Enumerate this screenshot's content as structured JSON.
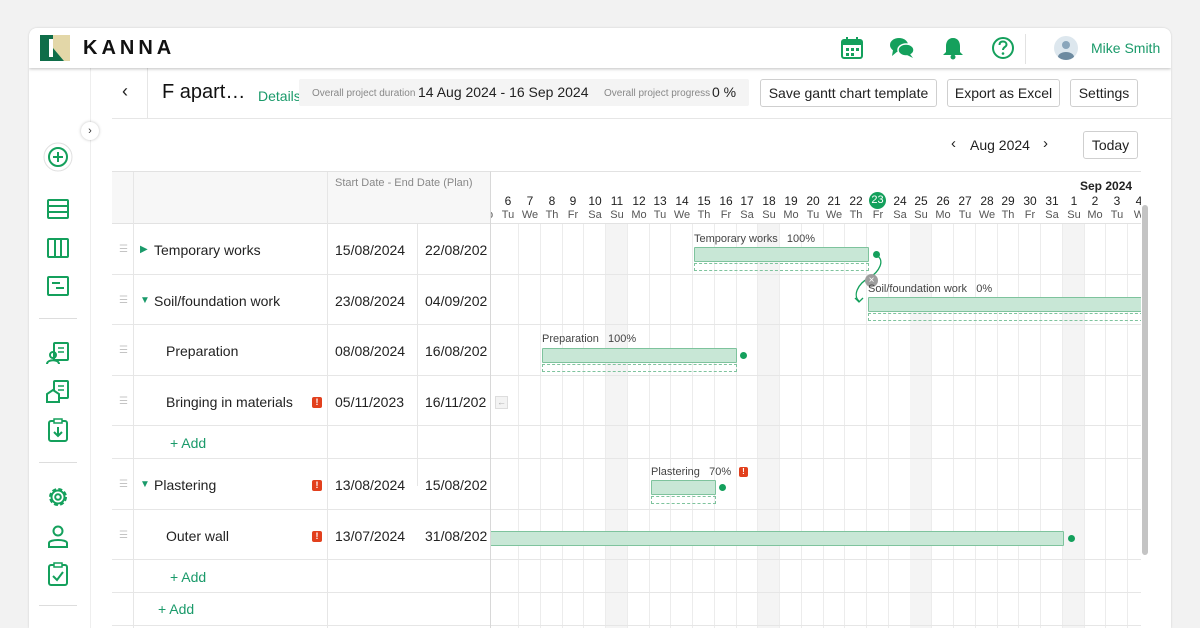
{
  "app": {
    "brand": "KANNA",
    "user_name": "Mike Smith",
    "colors": {
      "accent": "#1a9a6a",
      "bar_fill": "#c8e7d6",
      "warning": "#e2401d"
    },
    "top_icons": [
      "calendar-icon",
      "chat-icon",
      "bell-icon",
      "help-icon"
    ]
  },
  "sidebar": {
    "items": [
      "add-icon",
      "list-icon",
      "board-icon",
      "schedule-icon",
      "customer-list-icon",
      "building-icon",
      "clipboard-download-icon",
      "settings-icon",
      "user-icon",
      "checklist-icon"
    ]
  },
  "header": {
    "title": "F apart…",
    "details": "Details",
    "duration_label": "Overall project duration",
    "duration_value": "14 Aug 2024 - 16 Sep 2024",
    "progress_label": "Overall project progress",
    "progress_value": "0 %",
    "buttons": {
      "save_template": "Save gantt chart template",
      "export": "Export as Excel",
      "settings": "Settings"
    }
  },
  "nav": {
    "month": "Aug 2024",
    "today": "Today"
  },
  "table": {
    "date_header": "Start Date - End Date (Plan)",
    "rows": [
      {
        "name": "Temporary works",
        "start": "15/08/2024",
        "end": "22/08/202"
      },
      {
        "name": "Soil/foundation work",
        "start": "23/08/2024",
        "end": "04/09/202"
      },
      {
        "name": "Preparation",
        "start": "08/08/2024",
        "end": "16/08/202"
      },
      {
        "name": "Bringing in materials",
        "start": "05/11/2023",
        "end": "16/11/202"
      },
      {
        "name": "Plastering",
        "start": "13/08/2024",
        "end": "15/08/202"
      },
      {
        "name": "Outer wall",
        "start": "13/07/2024",
        "end": "31/08/202"
      }
    ],
    "add_label": "+ Add"
  },
  "gantt": {
    "month_label": "Sep 2024",
    "weekday_first": "o",
    "days": [
      {
        "d": "6",
        "w": "Tu"
      },
      {
        "d": "7",
        "w": "We"
      },
      {
        "d": "8",
        "w": "Th"
      },
      {
        "d": "9",
        "w": "Fr"
      },
      {
        "d": "10",
        "w": "Sa"
      },
      {
        "d": "11",
        "w": "Su"
      },
      {
        "d": "12",
        "w": "Mo"
      },
      {
        "d": "13",
        "w": "Tu"
      },
      {
        "d": "14",
        "w": "We"
      },
      {
        "d": "15",
        "w": "Th"
      },
      {
        "d": "16",
        "w": "Fr"
      },
      {
        "d": "17",
        "w": "Sa"
      },
      {
        "d": "18",
        "w": "Su"
      },
      {
        "d": "19",
        "w": "Mo"
      },
      {
        "d": "20",
        "w": "Tu"
      },
      {
        "d": "21",
        "w": "We"
      },
      {
        "d": "22",
        "w": "Th"
      },
      {
        "d": "23",
        "w": "Fr"
      },
      {
        "d": "24",
        "w": "Sa"
      },
      {
        "d": "25",
        "w": "Su"
      },
      {
        "d": "26",
        "w": "Mo"
      },
      {
        "d": "27",
        "w": "Tu"
      },
      {
        "d": "28",
        "w": "We"
      },
      {
        "d": "29",
        "w": "Th"
      },
      {
        "d": "30",
        "w": "Fr"
      },
      {
        "d": "31",
        "w": "Sa"
      },
      {
        "d": "1",
        "w": "Su"
      },
      {
        "d": "2",
        "w": "Mo"
      },
      {
        "d": "3",
        "w": "Tu"
      },
      {
        "d": "4",
        "w": "W"
      }
    ],
    "bars": [
      {
        "label": "Temporary works",
        "progress": "100%"
      },
      {
        "label": "Soil/foundation work",
        "progress": "0%"
      },
      {
        "label": "Preparation",
        "progress": "100%"
      },
      {
        "label": "Plastering",
        "progress": "70%"
      }
    ]
  }
}
